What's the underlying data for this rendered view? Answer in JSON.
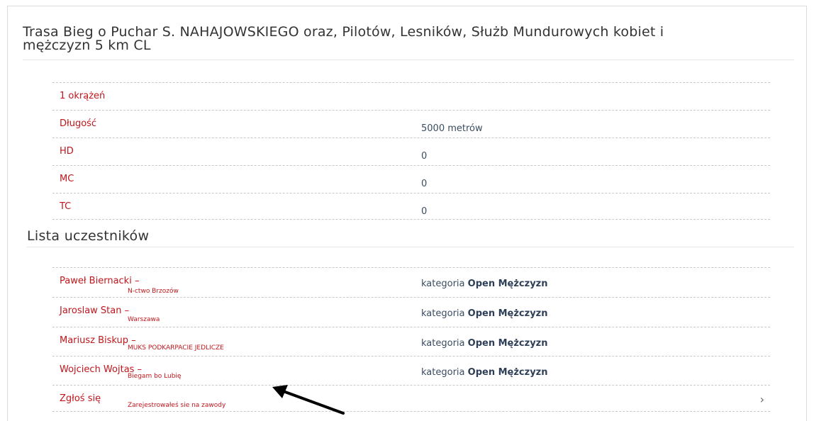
{
  "route": {
    "title_line1": "Trasa Bieg o Puchar S. NAHAJOWSKIEGO oraz, Pilotów, Lesników, Służb Mundurowych kobiet i",
    "title_line2": "mężczyzn 5 km CL"
  },
  "route_details": [
    {
      "label": "1 okrążeń",
      "value": ""
    },
    {
      "label": "Długość",
      "value": "5000 metrów"
    },
    {
      "label": "HD",
      "value": "0"
    },
    {
      "label": "MC",
      "value": "0"
    },
    {
      "label": "TC",
      "value": "0"
    }
  ],
  "participants": {
    "heading": "Lista uczestników",
    "category_prefix": "kategoria",
    "items": [
      {
        "name": "Paweł Biernacki –",
        "club": "N-ctwo Brzozów",
        "category": "Open Mężczyzn"
      },
      {
        "name": "Jaroslaw Stan –",
        "club": "Warszawa",
        "category": "Open Mężczyzn"
      },
      {
        "name": "Mariusz Biskup –",
        "club": "MUKS PODKARPACIE JEDLICZE",
        "category": "Open Mężczyzn"
      },
      {
        "name": "Wojciech Wojtas –",
        "club": "Biegam bo Lubię",
        "category": "Open Mężczyzn"
      }
    ]
  },
  "register": {
    "label": "Zgłoś się",
    "note": "Zarejestrowałeś sie na zawody",
    "chevron_icon": "chevron-right-icon"
  },
  "annotation": {
    "icon": "arrow-pointer-icon",
    "color": "#000000"
  },
  "colors": {
    "label_red": "#c0161c",
    "value_blue": "#3b4d61"
  }
}
